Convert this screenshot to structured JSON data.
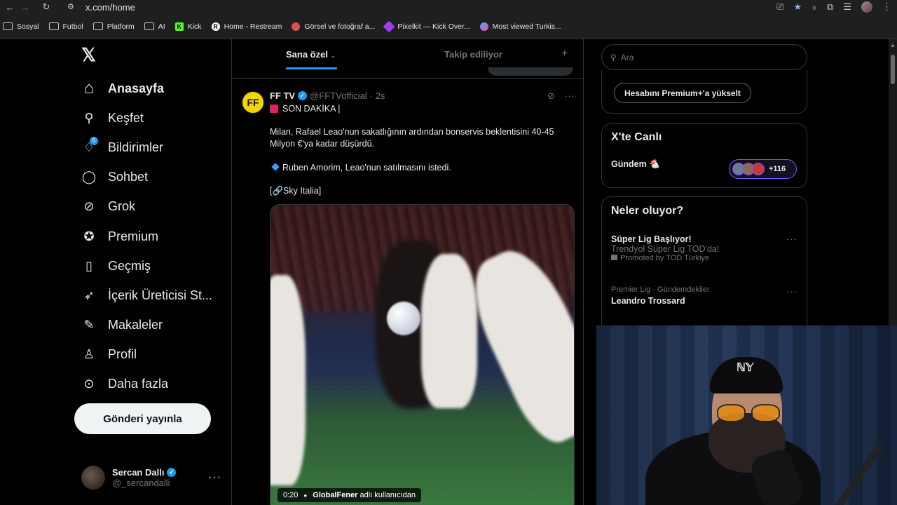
{
  "browser": {
    "url": "x.com/home",
    "bookmarks": [
      {
        "label": "Sosyal",
        "icon": "folder-icon"
      },
      {
        "label": "Futbol",
        "icon": "folder-icon"
      },
      {
        "label": "Platform",
        "icon": "folder-icon"
      },
      {
        "label": "AI",
        "icon": "folder-icon"
      },
      {
        "label": "Kick",
        "icon": "kick-icon"
      },
      {
        "label": "Home - Restream",
        "icon": "restream-icon"
      },
      {
        "label": "Görsel ve fotoğraf a...",
        "icon": "image-site-icon"
      },
      {
        "label": "Pixelkit — Kick Over...",
        "icon": "pixelkit-icon"
      },
      {
        "label": "Most viewed Turkis...",
        "icon": "globe-icon"
      }
    ]
  },
  "sidebar": {
    "logo": "𝕏",
    "items": [
      {
        "label": "Anasayfa",
        "icon": "home-icon",
        "glyph": "⌂",
        "active": true
      },
      {
        "label": "Keşfet",
        "icon": "search-icon",
        "glyph": "⚲"
      },
      {
        "label": "Bildirimler",
        "icon": "bell-icon",
        "glyph": "♢",
        "badge": "5"
      },
      {
        "label": "Sohbet",
        "icon": "chat-icon",
        "glyph": "◯"
      },
      {
        "label": "Grok",
        "icon": "grok-icon",
        "glyph": "⊘"
      },
      {
        "label": "Premium",
        "icon": "premium-icon",
        "glyph": "✪"
      },
      {
        "label": "Geçmiş",
        "icon": "bookmark-icon",
        "glyph": "▯"
      },
      {
        "label": "İçerik Üreticisi St...",
        "icon": "rocket-icon",
        "glyph": "➶"
      },
      {
        "label": "Makaleler",
        "icon": "articles-icon",
        "glyph": "✎"
      },
      {
        "label": "Profil",
        "icon": "profile-icon",
        "glyph": "♙"
      },
      {
        "label": "Daha fazla",
        "icon": "more-circle-icon",
        "glyph": "⊙"
      }
    ],
    "post_button": "Gönderi yayınla",
    "user": {
      "name": "Sercan Dallı",
      "handle": "@_sercandalli"
    }
  },
  "feed": {
    "tabs": [
      "Sana özel",
      "Takip ediliyor"
    ],
    "tweet": {
      "author": "FF TV",
      "handle": "@FFTVofficial",
      "time": "· 2s",
      "line1": "SON DAKİKA |",
      "line2": "Milan, Rafael Leao'nun sakatlığının ardından bonservis beklentisini 40-45 Milyon €'ya kadar düşürdü.",
      "line3": "Ruben Amorim, Leao'nun satılmasını istedi.",
      "line4": "[🔗Sky Italia]",
      "video_time": "0:20",
      "video_credit_user": "GlobalFener",
      "video_credit_suffix": "adlı kullanıcıdan"
    }
  },
  "right": {
    "search_placeholder": "Ara",
    "premium_button": "Hesabını Premium+'a yükselt",
    "live": {
      "title": "X'te Canlı",
      "row": "Gündem 🐔",
      "count": "+116"
    },
    "trends": {
      "title": "Neler oluyor?",
      "items": [
        {
          "meta": "",
          "title": "Süper Lig Başlıyor!",
          "sub": "Trendyol Süper Lig TOD'da!",
          "promo": "Promoted by TOD Türkiye"
        },
        {
          "meta": "Premier Lig · Gündemdekiler",
          "title": "Leandro Trossard",
          "sub": "",
          "promo": ""
        }
      ]
    }
  },
  "colors": {
    "accent": "#1d9bf0",
    "live_border": "#7856ff",
    "background": "#000000"
  }
}
